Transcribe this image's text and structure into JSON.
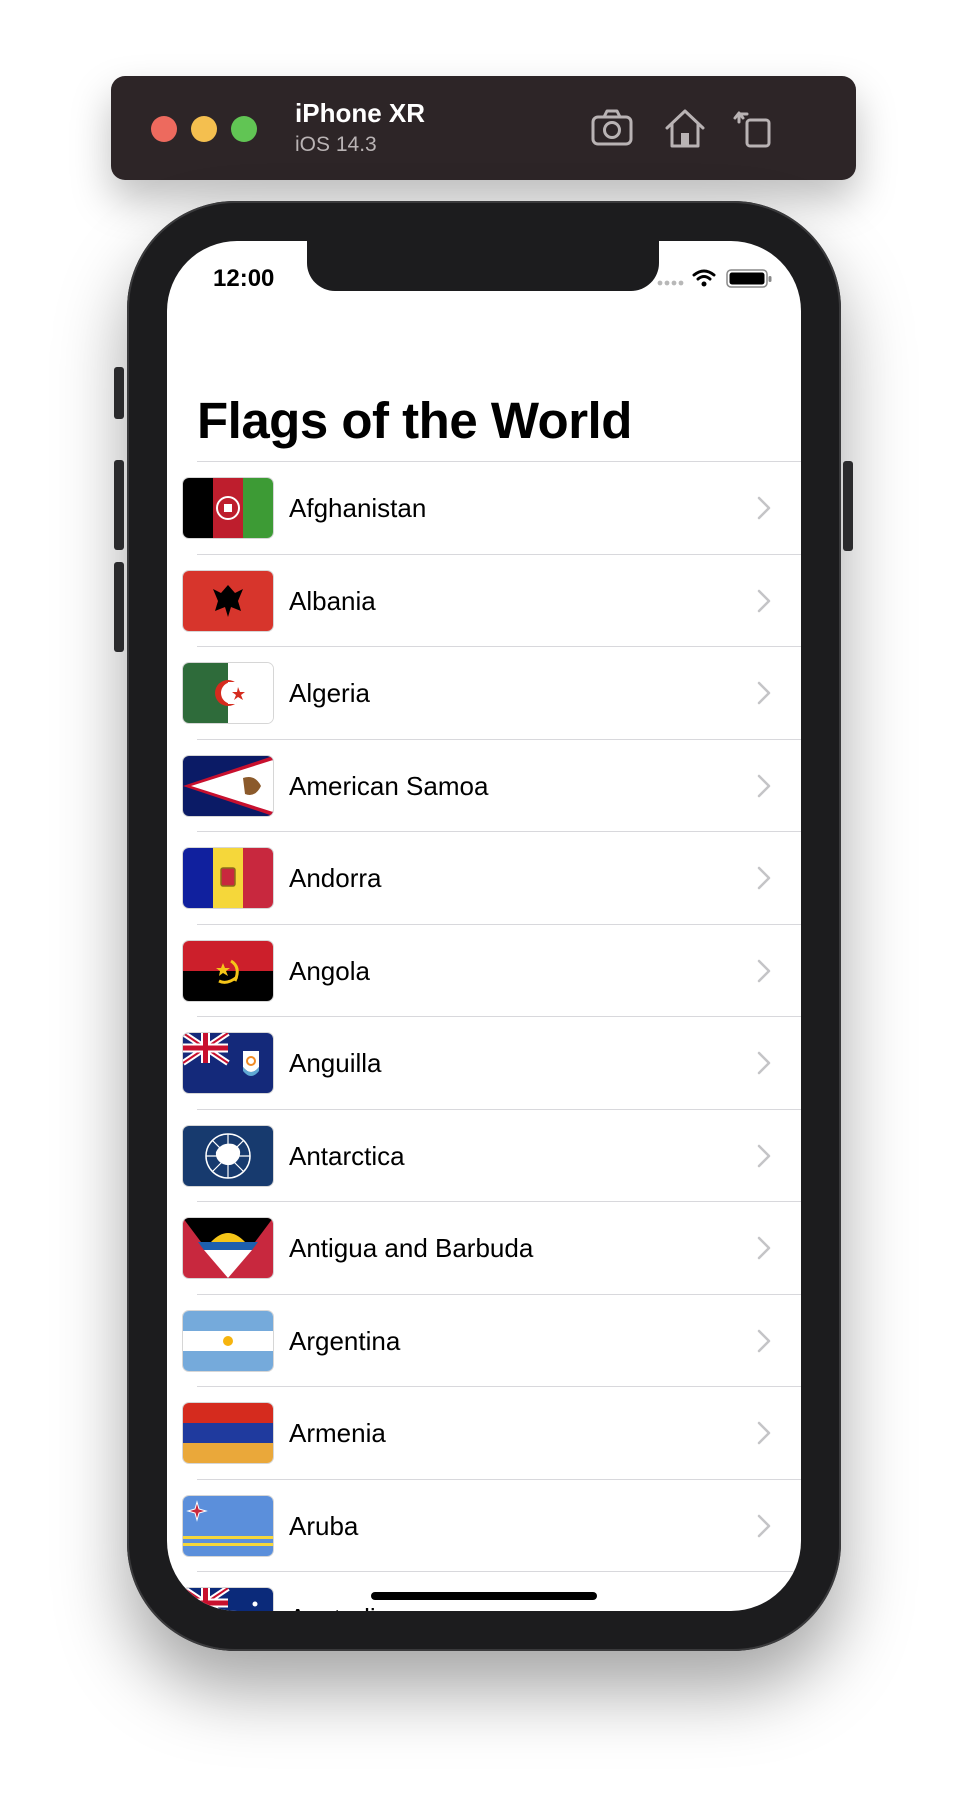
{
  "simulator": {
    "device_name": "iPhone XR",
    "os_version": "iOS 14.3",
    "buttons": [
      "screenshot-icon",
      "home-icon",
      "rotate-icon"
    ]
  },
  "status_bar": {
    "time": "12:00"
  },
  "nav": {
    "title": "Flags of the World"
  },
  "countries": [
    {
      "name": "Afghanistan",
      "flag": "afghanistan-flag-icon"
    },
    {
      "name": "Albania",
      "flag": "albania-flag-icon"
    },
    {
      "name": "Algeria",
      "flag": "algeria-flag-icon"
    },
    {
      "name": "American Samoa",
      "flag": "american-samoa-flag-icon"
    },
    {
      "name": "Andorra",
      "flag": "andorra-flag-icon"
    },
    {
      "name": "Angola",
      "flag": "angola-flag-icon"
    },
    {
      "name": "Anguilla",
      "flag": "anguilla-flag-icon"
    },
    {
      "name": "Antarctica",
      "flag": "antarctica-flag-icon"
    },
    {
      "name": "Antigua and Barbuda",
      "flag": "antigua-and-barbuda-flag-icon"
    },
    {
      "name": "Argentina",
      "flag": "argentina-flag-icon"
    },
    {
      "name": "Armenia",
      "flag": "armenia-flag-icon"
    },
    {
      "name": "Aruba",
      "flag": "aruba-flag-icon"
    },
    {
      "name": "Australia",
      "flag": "australia-flag-icon"
    }
  ]
}
